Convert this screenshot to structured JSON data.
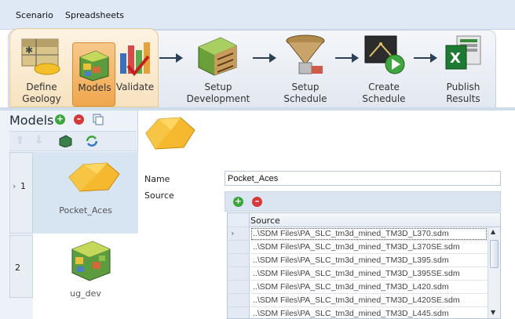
{
  "menu": {
    "items": [
      "Scenario",
      "Spreadsheets"
    ]
  },
  "workflow": {
    "steps": [
      {
        "label_line1": "Define",
        "label_line2": "Geology"
      },
      {
        "label_line1": "Models",
        "label_line2": ""
      },
      {
        "label_line1": "Validate",
        "label_line2": ""
      },
      {
        "label_line1": "Setup",
        "label_line2": "Development"
      },
      {
        "label_line1": "Setup",
        "label_line2": "Schedule"
      },
      {
        "label_line1": "Create",
        "label_line2": "Schedule"
      },
      {
        "label_line1": "Publish",
        "label_line2": "Results"
      }
    ]
  },
  "models_panel": {
    "title": "Models",
    "items": [
      {
        "number": "1",
        "name": "Pocket_Aces"
      },
      {
        "number": "2",
        "name": "ug_dev"
      }
    ]
  },
  "detail": {
    "name_label": "Name",
    "name_value": "Pocket_Aces",
    "source_label": "Source",
    "grid_header": "Source",
    "rows": [
      "..\\SDM Files\\PA_SLC_tm3d_mined_TM3D_L370.sdm",
      "..\\SDM Files\\PA_SLC_tm3d_mined_TM3D_L370SE.sdm",
      "..\\SDM Files\\PA_SLC_tm3d_mined_TM3D_L395.sdm",
      "..\\SDM Files\\PA_SLC_tm3d_mined_TM3D_L395SE.sdm",
      "..\\SDM Files\\PA_SLC_tm3d_mined_TM3D_L420.sdm",
      "..\\SDM Files\\PA_SLC_tm3d_mined_TM3D_L420SE.sdm",
      "..\\SDM Files\\PA_SLC_tm3d_mined_TM3D_L445.sdm"
    ]
  },
  "colors": {
    "accent_orange": "#f0a74e",
    "add_green": "#3aa53a",
    "remove_red": "#d43a3a",
    "panel_blue": "#edf2f8"
  }
}
